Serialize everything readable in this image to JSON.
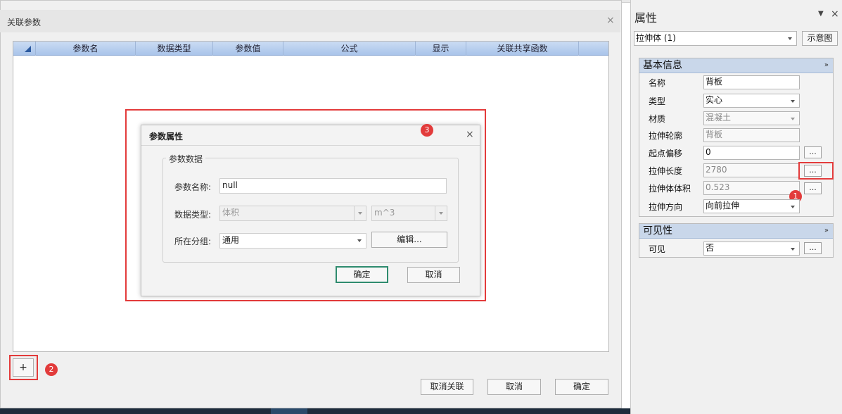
{
  "relation_dialog": {
    "title": "关联参数",
    "close_glyph": "×",
    "table": {
      "columns": [
        "参数名",
        "数据类型",
        "参数值",
        "公式",
        "显示",
        "关联共享函数"
      ]
    },
    "add_button": "+",
    "buttons": {
      "unlink": "取消关联",
      "cancel": "取消",
      "ok": "确定"
    }
  },
  "param_dialog": {
    "title": "参数属性",
    "close_glyph": "×",
    "group_title": "参数数据",
    "name_label": "参数名称:",
    "name_value": "null",
    "type_label": "数据类型:",
    "type_value": "体积",
    "unit_value": "m^3",
    "group_label": "所在分组:",
    "group_value": "通用",
    "edit_button": "编辑...",
    "ok_button": "确定",
    "cancel_button": "取消"
  },
  "badges": {
    "one": "1",
    "two": "2",
    "three": "3"
  },
  "properties": {
    "title": "属性",
    "pin_glyph": "▼",
    "close_glyph": "×",
    "object_select": "拉伸体 (1)",
    "preview_button": "示意图",
    "basic_section": "基本信息",
    "rows": [
      {
        "label": "名称",
        "value": "背板"
      },
      {
        "label": "类型",
        "value": "实心"
      },
      {
        "label": "材质",
        "value": "混凝土"
      },
      {
        "label": "拉伸轮廓",
        "value": "背板"
      },
      {
        "label": "起点偏移",
        "value": "0"
      },
      {
        "label": "拉伸长度",
        "value": "2780"
      },
      {
        "label": "拉伸体体积",
        "value": "0.523"
      },
      {
        "label": "拉伸方向",
        "value": "向前拉伸"
      }
    ],
    "visibility_section": "可见性",
    "visible_label": "可见",
    "visible_value": "否",
    "dots_glyph": "...",
    "chevron_glyph": "»"
  },
  "colors": {
    "accent_red": "#e23b3b",
    "header_blue": "#c9d7ea",
    "ok_border": "#2e8b6e"
  }
}
